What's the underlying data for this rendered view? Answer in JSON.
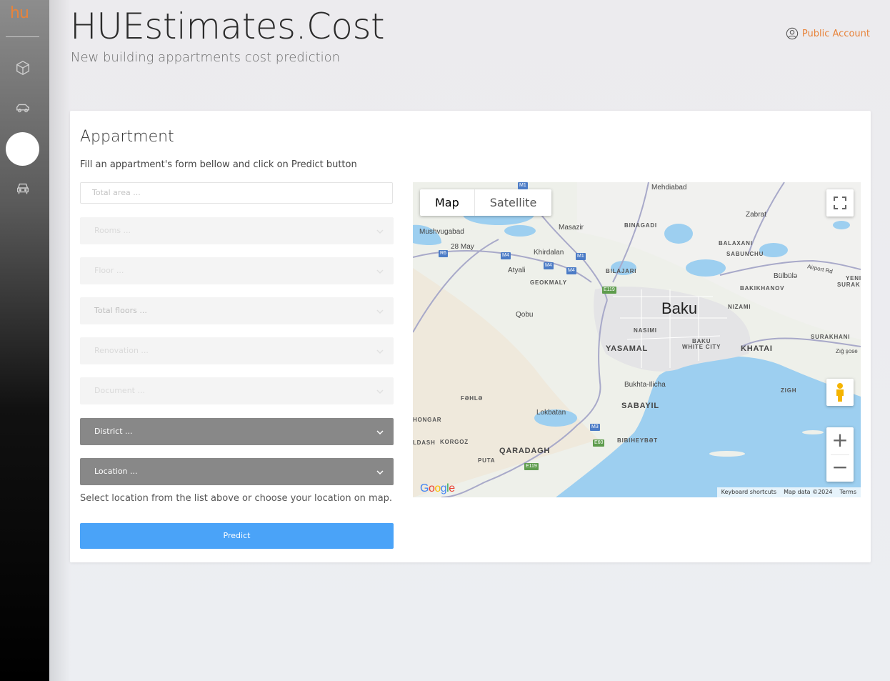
{
  "sidebar": {
    "logo": "hu",
    "items": [
      {
        "icon": "cube-icon"
      },
      {
        "icon": "car-icon"
      },
      {
        "icon": "circle-active"
      },
      {
        "icon": "car-front-icon"
      }
    ]
  },
  "header": {
    "title": "HUEstimates.Cost",
    "subtitle": "New building appartments cost prediction",
    "account_label": "Public Account"
  },
  "form": {
    "title": "Appartment",
    "description": "Fill an appartment's form bellow and click on Predict button",
    "total_area_placeholder": "Total area ...",
    "rooms_label": "Rooms ...",
    "floor_label": "Floor ...",
    "total_floors_label": "Total floors ...",
    "renovation_label": "Renovation ...",
    "document_label": "Document ...",
    "district_label": "District ...",
    "location_label": "Location ...",
    "hint": "Select location from the list above or choose your location on map.",
    "predict_label": "Predict"
  },
  "map": {
    "tab_map": "Map",
    "tab_satellite": "Satellite",
    "google": "Google",
    "footer": {
      "shortcuts": "Keyboard shortcuts",
      "data": "Map data ©2024",
      "terms": "Terms"
    },
    "labels": {
      "mehdiabad": "Mehdiabad",
      "zabrat": "Zabrat",
      "mushvugabad": "Mushvugabad",
      "masazir": "Masazir",
      "binagadi": "BINAGADI",
      "may28": "28 May",
      "khirdalan": "Khirdalan",
      "balaxani": "BALAXANI",
      "sabunchu": "SABUNCHU",
      "atyali": "Atyali",
      "bilajari": "BILAJARI",
      "bulbula": "Bülbülə",
      "airport": "Airport Rd",
      "yeni_surakhani_1": "YENI",
      "yeni_surakhani_2": "SURAKHAN",
      "geokmaly": "GEOKMALY",
      "bakikhanov": "BAKIKHANOV",
      "qobu": "Qobu",
      "baku": "Baku",
      "nizami": "NIZAMI",
      "nasimi": "NASIMI",
      "surakhani": "SURAKHANI",
      "baku_white_city_1": "BAKU",
      "baku_white_city_2": "WHITE CITY",
      "yasamal": "YASAMAL",
      "khatai": "KHATAI",
      "zigh_sose": "Zığ şose",
      "bukhta": "Bukhta-Ilicha",
      "zigh": "ZIGH",
      "fehle": "FƏHLƏ",
      "sabayil": "SABAYIL",
      "lokbatan": "Lokbatan",
      "hongar": "HONGAR",
      "korgoz": "KORGOZ",
      "ldash": "LDASH",
      "bibiheybat": "BIBIHEYBƏT",
      "qaradagh": "QARADAGH",
      "puta": "PUTA",
      "m1": "M1",
      "m4": "M4",
      "m3": "M3",
      "r6": "R6",
      "e119": "E119",
      "e60": "E60"
    }
  }
}
